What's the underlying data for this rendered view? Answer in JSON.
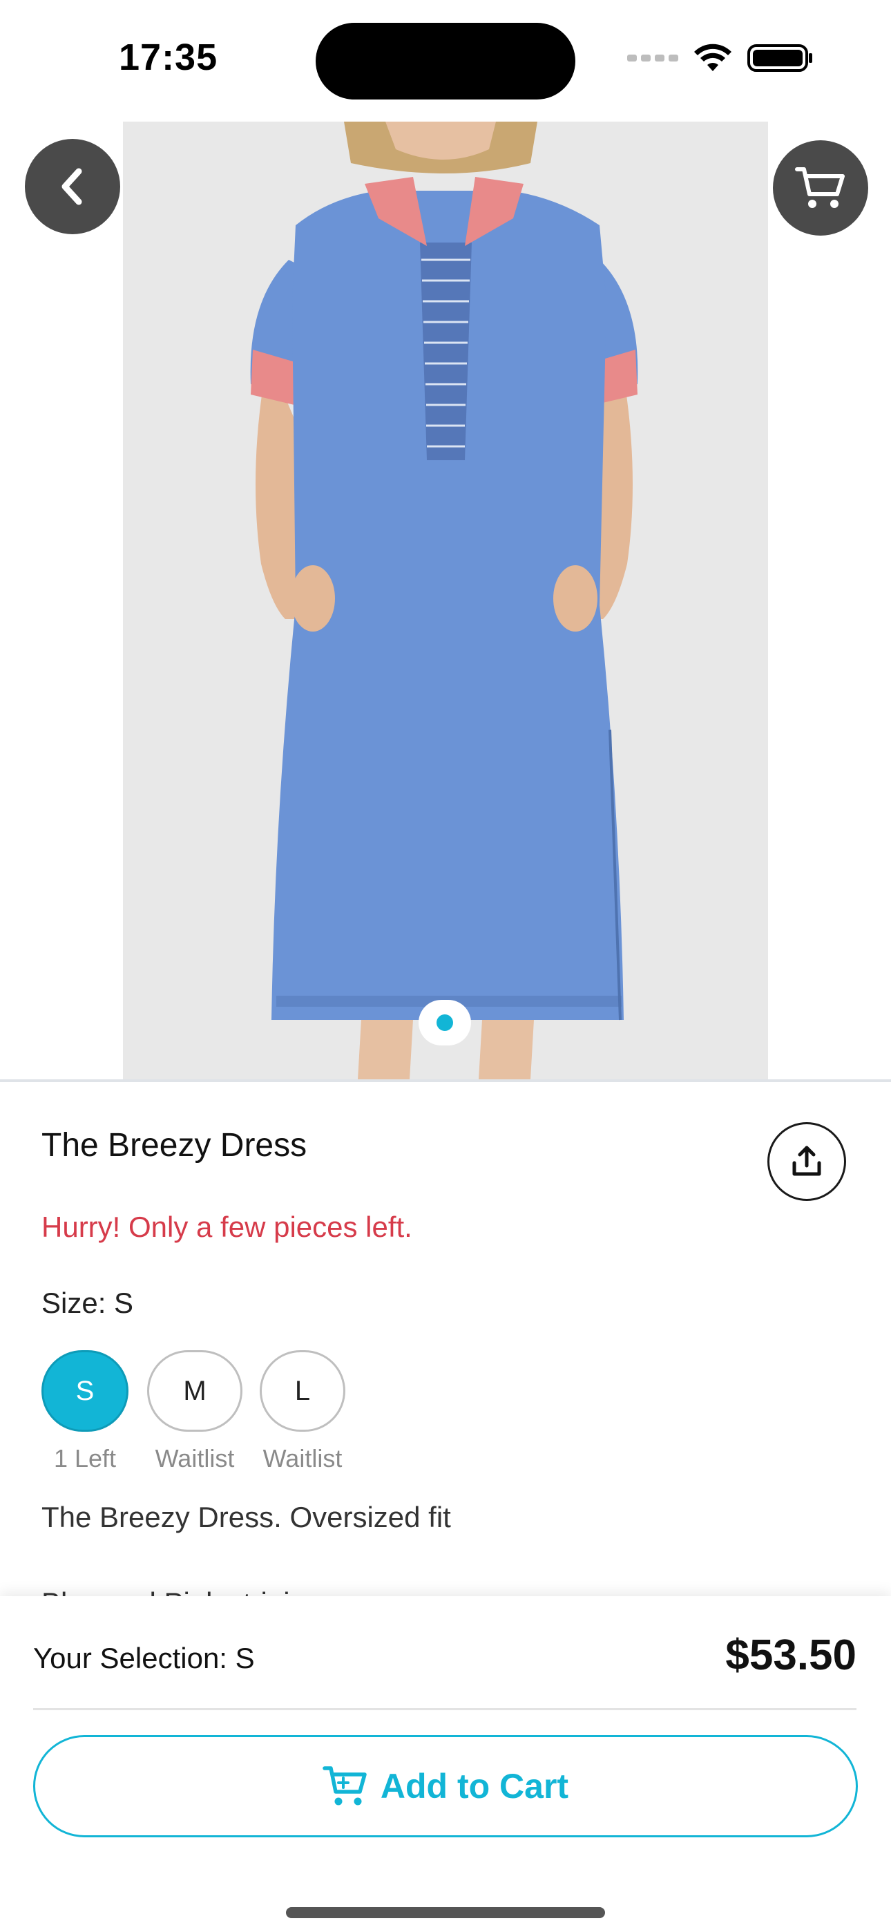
{
  "status_bar": {
    "time": "17:35"
  },
  "navigation": {
    "back_icon": "chevron-left-icon",
    "cart_icon": "cart-icon"
  },
  "gallery": {
    "image_count": 1,
    "active_index": 0
  },
  "product": {
    "title": "The Breezy Dress",
    "urgency": "Hurry! Only a few pieces left.",
    "size_label": "Size: S",
    "sizes": [
      {
        "label": "S",
        "status": "1 Left",
        "selected": true
      },
      {
        "label": "M",
        "status": "Waitlist",
        "selected": false
      },
      {
        "label": "L",
        "status": "Waitlist",
        "selected": false
      }
    ],
    "description": "The Breezy Dress. Oversized fit",
    "description_next_line": "Blue and Pink striping"
  },
  "checkout": {
    "selection_label": "Your Selection: S",
    "price": "$53.50",
    "add_to_cart_label": "Add to Cart"
  },
  "colors": {
    "accent": "#12b5d6",
    "urgency": "#d63b4a",
    "dress_blue": "#6b93d6",
    "collar_pink": "#e88a8a"
  }
}
